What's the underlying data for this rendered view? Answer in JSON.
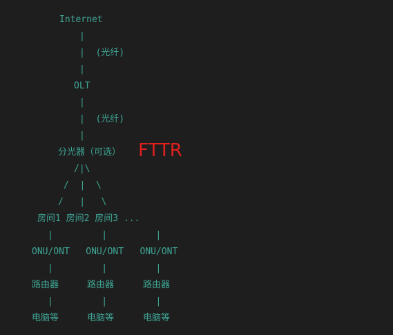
{
  "theme": {
    "background": "#1e1e1e",
    "text": "#3fa796",
    "accent": "#e0211f"
  },
  "lines": {
    "internet": "Internet",
    "pipe1": "|",
    "fiber1": "|  (光纤)",
    "pipe2": "|",
    "olt": "OLT",
    "pipe3": "|",
    "fiber2": "|  (光纤)",
    "pipe4": "|",
    "splitter": "分光器（可选）",
    "fork1": "/|\\",
    "fork2": "/  |  \\",
    "fork3": "/   |   \\",
    "rooms": "房间1 房间2 房间3 ...",
    "branch_pipe1": "|         |         |",
    "onu": "ONU/ONT   ONU/ONT   ONU/ONT",
    "branch_pipe2": "|         |         |",
    "routers": [
      "路由器",
      "路由器",
      "路由器"
    ],
    "branch_pipe3": "|         |         |",
    "computers": [
      "电脑等",
      "电脑等",
      "电脑等"
    ]
  },
  "annotation": {
    "label": "FTTR"
  }
}
